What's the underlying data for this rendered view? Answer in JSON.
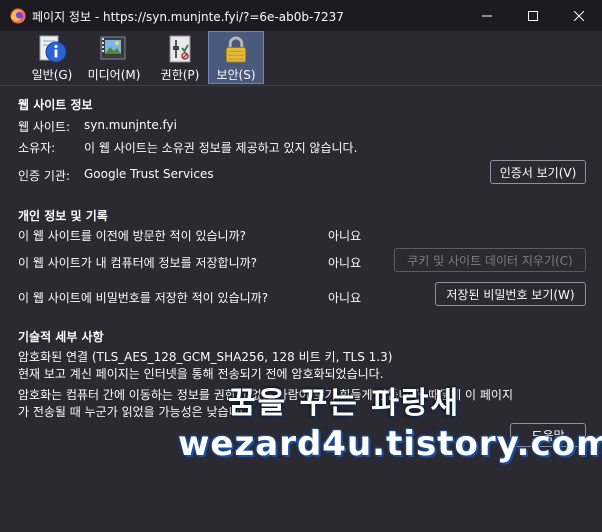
{
  "window": {
    "title": "페이지 정보 - https://syn.munjnte.fyi/?=6e-ab0b-7237",
    "controls": {
      "minimize": "—",
      "maximize": "☐",
      "close": "✕"
    }
  },
  "tabs": [
    {
      "label": "일반(G)",
      "icon": "info-icon"
    },
    {
      "label": "미디어(M)",
      "icon": "media-icon"
    },
    {
      "label": "권한(P)",
      "icon": "permissions-icon"
    },
    {
      "label": "보안(S)",
      "icon": "lock-icon",
      "selected": true
    }
  ],
  "website": {
    "heading": "웹 사이트 정보",
    "site_label": "웹 사이트:",
    "site_value": "syn.munjnte.fyi",
    "owner_label": "소유자:",
    "owner_value": "이 웹 사이트는 소유권 정보를 제공하고 있지 않습니다.",
    "verifier_label": "인증 기관:",
    "verifier_value": "Google Trust Services",
    "view_cert_button": "인증서 보기(V)"
  },
  "privacy": {
    "heading": "개인 정보 및 기록",
    "q1": "이 웹 사이트를 이전에 방문한 적이 있습니까?",
    "a1": "아니요",
    "q2": "이 웹 사이트가 내 컴퓨터에 정보를 저장합니까?",
    "a2": "아니요",
    "clear_cookies_button": "쿠키 및 사이트 데이터 지우기(C)",
    "q3": "이 웹 사이트에 비밀번호를 저장한 적이 있습니까?",
    "a3": "아니요",
    "view_passwords_button": "저장된 비밀번호 보기(W)"
  },
  "technical": {
    "heading": "기술적 세부 사항",
    "line1": "암호화된 연결 (TLS_AES_128_GCM_SHA256, 128 비트 키, TLS 1.3)",
    "line2": "현재 보고 계신 페이지는 인터넷을 통해 전송되기 전에 암호화되었습니다.",
    "line3": "암호화는 컴퓨터 간에 이동하는 정보를 권한이 없는 사람이 보기 힘들게 만듭니다. 때문에 이 페이지",
    "line4": "가 전송될 때 누군가 읽었을 가능성은 낮습니다."
  },
  "help_button": "도움말",
  "watermark": {
    "line1": "꿈을 꾸는 파랑새",
    "line2": "wezard4u.tistory.com"
  },
  "colors": {
    "background": "#2b2a33",
    "titlebar": "#1c1b22",
    "selected_tab": "#4a5a7c",
    "text": "#fbfbfe"
  }
}
